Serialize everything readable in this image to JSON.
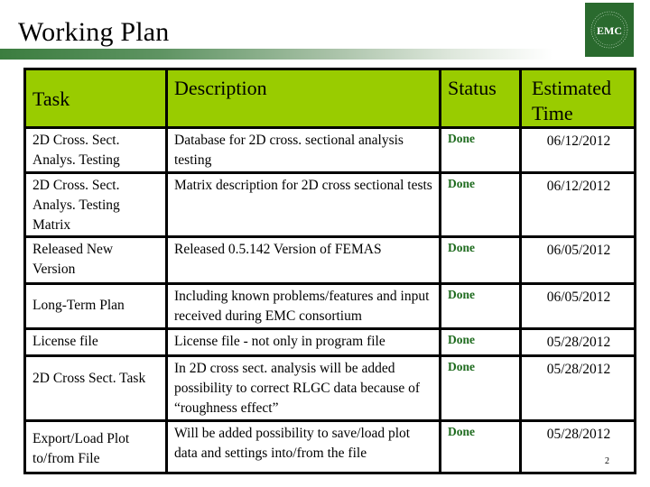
{
  "slide": {
    "title": "Working Plan",
    "page_number": "2",
    "accent_color": "#99cc00",
    "status_color": "#1e6b1e"
  },
  "logo": {
    "text": "EMC",
    "ring_text": "MISSOURI S&T ELECTROMAGNETIC COMPATIBILITY LABORATORY",
    "icon": "emc-lab-logo-icon",
    "color": "#2a6a2e"
  },
  "table": {
    "headers": {
      "task": "Task",
      "description": "Description",
      "status": "Status",
      "time_line1": "Estimated",
      "time_line2": "Time"
    },
    "rows": [
      {
        "task": "2D Cross. Sect. Analys. Testing",
        "description": "Database for 2D cross. sectional analysis testing",
        "status": "Done",
        "time": "06/12/2012"
      },
      {
        "task": "2D Cross. Sect. Analys. Testing Matrix",
        "description": "Matrix description for 2D cross sectional tests",
        "status": "Done",
        "time": "06/12/2012"
      },
      {
        "task": "Released New Version",
        "description": "Released 0.5.142 Version of FEMAS",
        "status": "Done",
        "time": "06/05/2012"
      },
      {
        "task": "Long-Term Plan",
        "description": "Including known problems/features and input received during EMC consortium",
        "status": "Done",
        "time": "06/05/2012"
      },
      {
        "task": "License file",
        "description": "License file - not only in program file",
        "status": "Done",
        "time": "05/28/2012"
      },
      {
        "task": " 2D Cross Sect. Task",
        "description": "In 2D cross sect. analysis will be added possibility to correct RLGC data because of “roughness effect”",
        "status": "Done",
        "time": "05/28/2012"
      },
      {
        "task": "Export/Load Plot to/from File",
        "description": "Will be added possibility to save/load plot data and settings into/from the file",
        "status": "Done",
        "time": "05/28/2012"
      }
    ]
  }
}
